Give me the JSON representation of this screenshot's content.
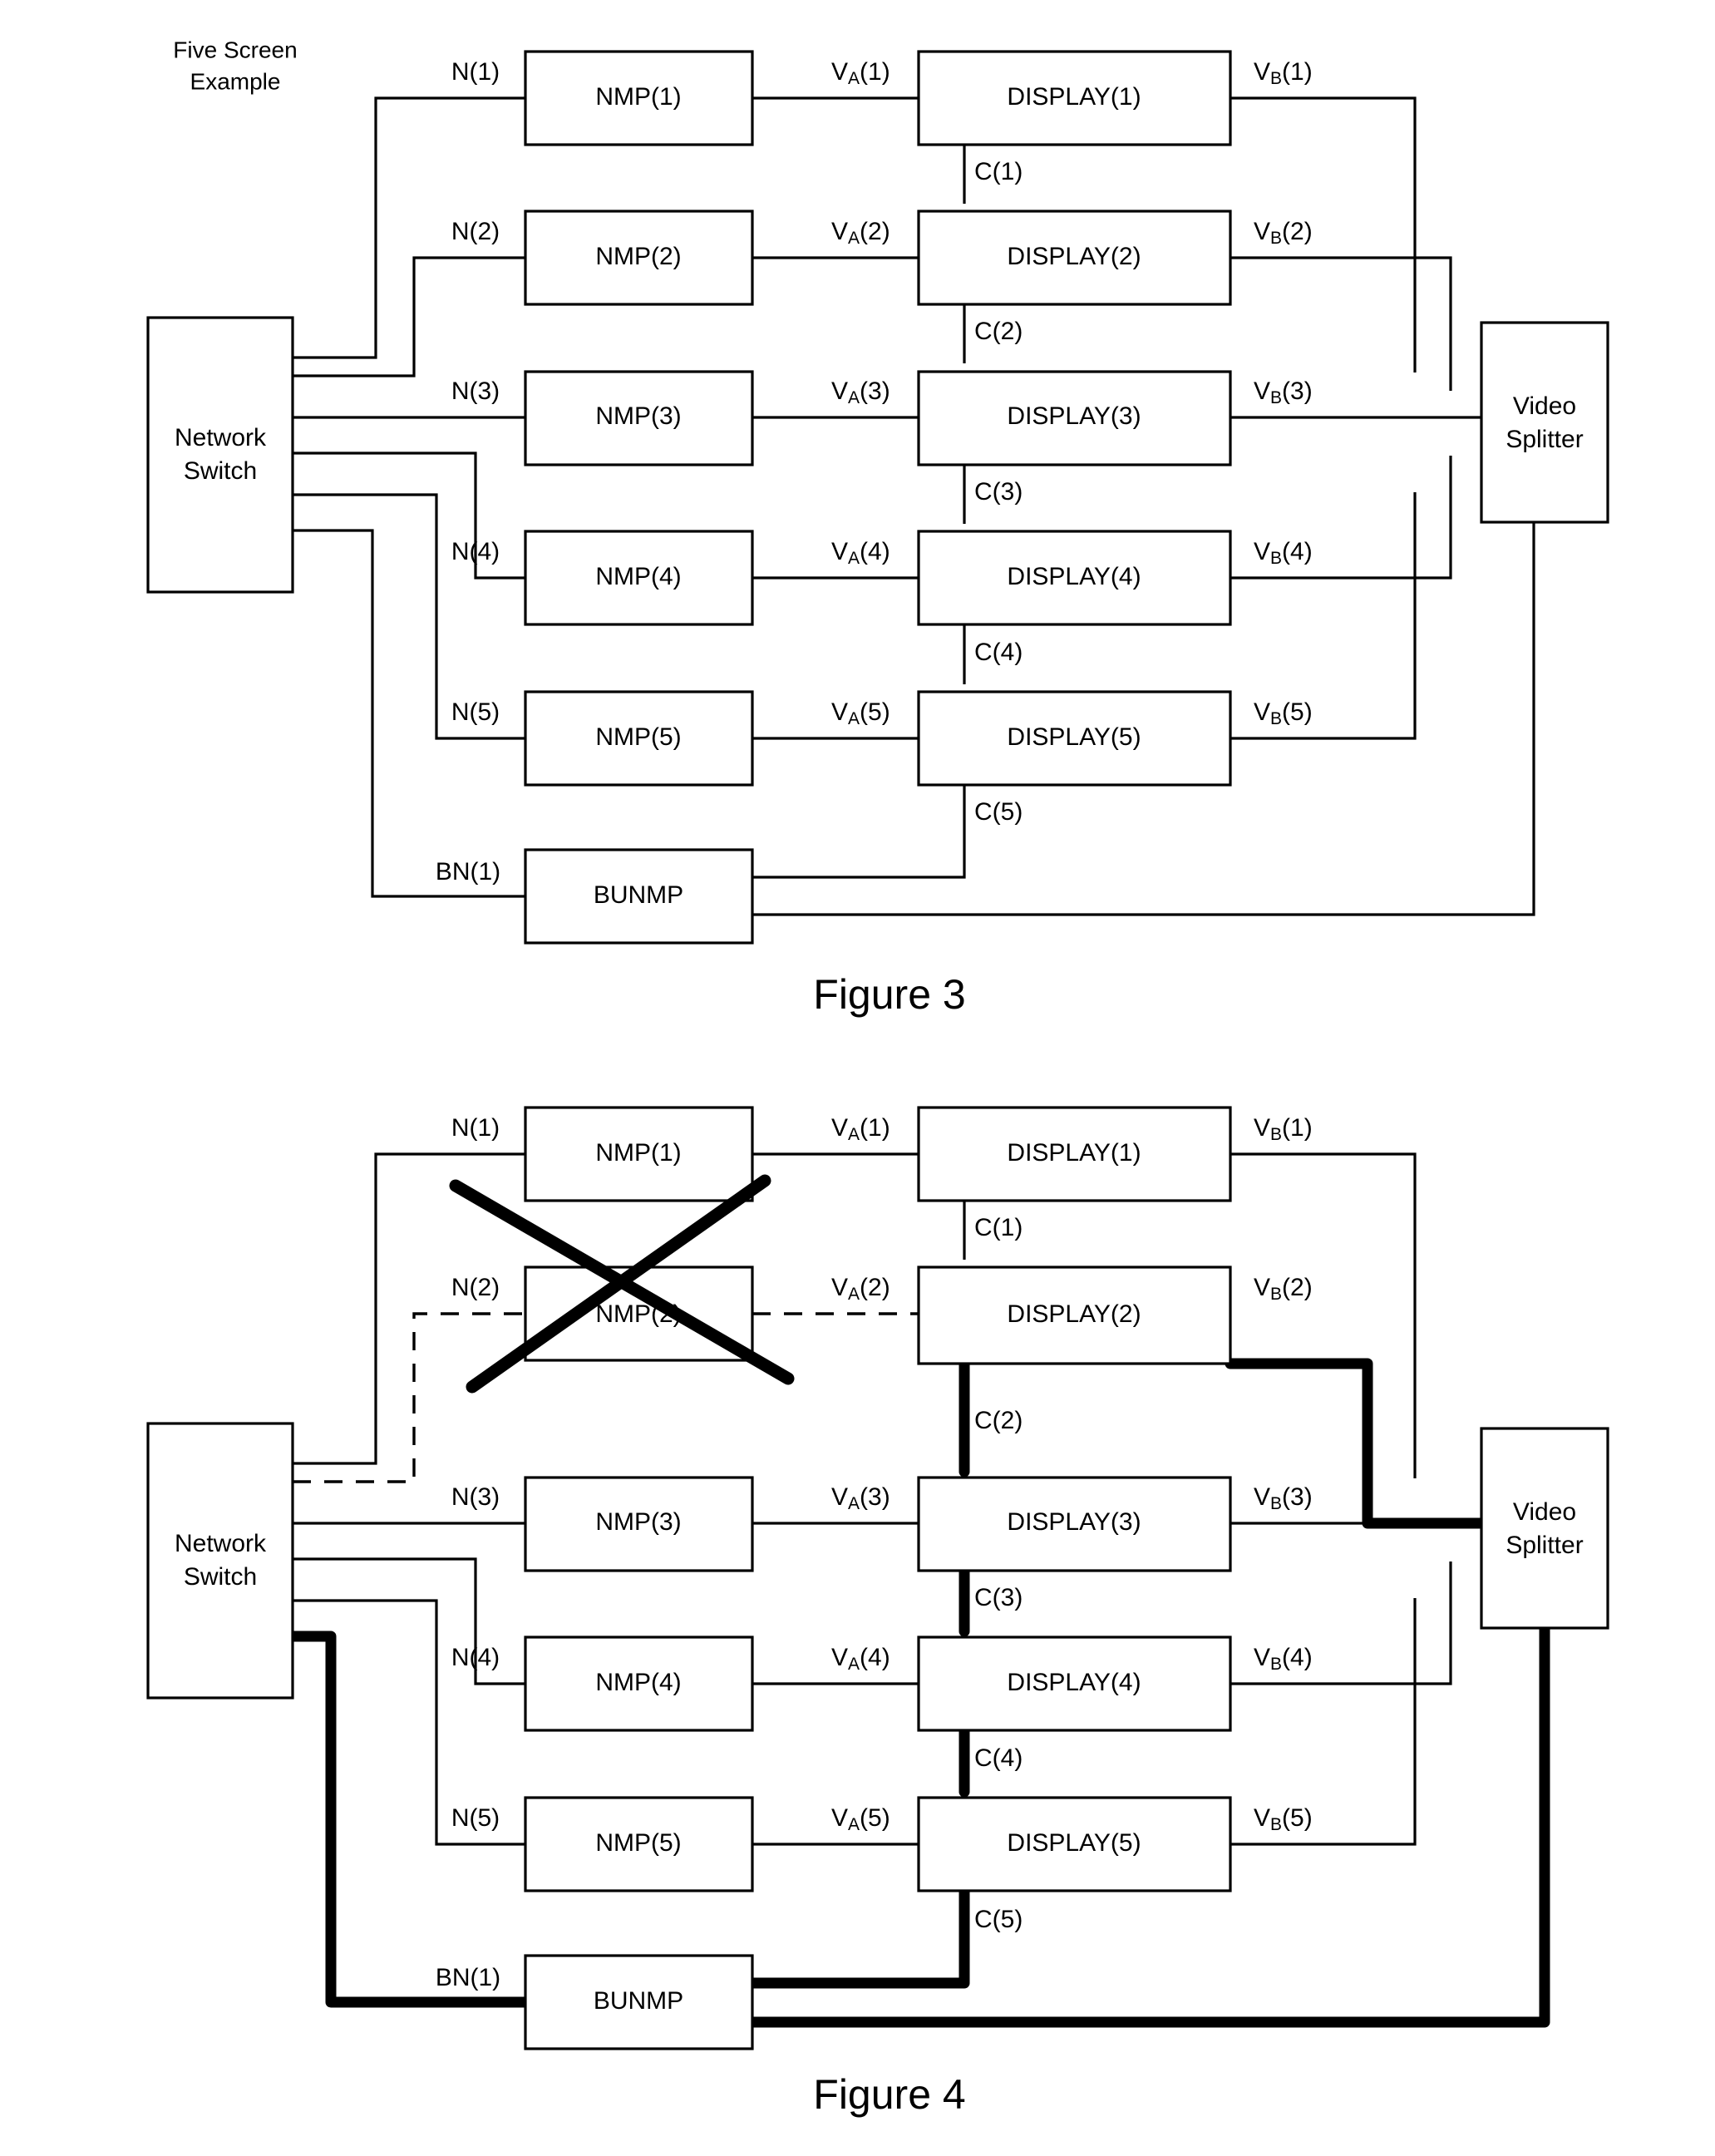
{
  "figures": [
    {
      "id": "figure-3",
      "caption": "Figure 3",
      "note": [
        "Five Screen",
        "Example"
      ],
      "switch_label": [
        "Network",
        "Switch"
      ],
      "splitter_label": [
        "Video",
        "Splitter"
      ],
      "bunmp_label": "BUNMP",
      "bn_label": "BN(1)",
      "rows": [
        {
          "n": "N(1)",
          "nmp": "NMP(1)",
          "va_pre": "V",
          "va_sub": "A",
          "va_post": "(1)",
          "display": "DISPLAY(1)",
          "vb_pre": "V",
          "vb_sub": "B",
          "vb_post": "(1)",
          "c": "C(1)"
        },
        {
          "n": "N(2)",
          "nmp": "NMP(2)",
          "va_pre": "V",
          "va_sub": "A",
          "va_post": "(2)",
          "display": "DISPLAY(2)",
          "vb_pre": "V",
          "vb_sub": "B",
          "vb_post": "(2)",
          "c": "C(2)"
        },
        {
          "n": "N(3)",
          "nmp": "NMP(3)",
          "va_pre": "V",
          "va_sub": "A",
          "va_post": "(3)",
          "display": "DISPLAY(3)",
          "vb_pre": "V",
          "vb_sub": "B",
          "vb_post": "(3)",
          "c": "C(3)"
        },
        {
          "n": "N(4)",
          "nmp": "NMP(4)",
          "va_pre": "V",
          "va_sub": "A",
          "va_post": "(4)",
          "display": "DISPLAY(4)",
          "vb_pre": "V",
          "vb_sub": "B",
          "vb_post": "(4)",
          "c": "C(4)"
        },
        {
          "n": "N(5)",
          "nmp": "NMP(5)",
          "va_pre": "V",
          "va_sub": "A",
          "va_post": "(5)",
          "display": "DISPLAY(5)",
          "vb_pre": "V",
          "vb_sub": "B",
          "vb_post": "(5)",
          "c": "C(5)"
        }
      ]
    },
    {
      "id": "figure-4",
      "caption": "Figure 4",
      "note": [
        "",
        ""
      ],
      "switch_label": [
        "Network",
        "Switch"
      ],
      "splitter_label": [
        "Video",
        "Splitter"
      ],
      "bunmp_label": "BUNMP",
      "bn_label": "BN(1)",
      "failed_row_index": 1,
      "rows": [
        {
          "n": "N(1)",
          "nmp": "NMP(1)",
          "va_pre": "V",
          "va_sub": "A",
          "va_post": "(1)",
          "display": "DISPLAY(1)",
          "vb_pre": "V",
          "vb_sub": "B",
          "vb_post": "(1)",
          "c": "C(1)"
        },
        {
          "n": "N(2)",
          "nmp": "NMP(2)",
          "va_pre": "V",
          "va_sub": "A",
          "va_post": "(2)",
          "display": "DISPLAY(2)",
          "vb_pre": "V",
          "vb_sub": "B",
          "vb_post": "(2)",
          "c": "C(2)"
        },
        {
          "n": "N(3)",
          "nmp": "NMP(3)",
          "va_pre": "V",
          "va_sub": "A",
          "va_post": "(3)",
          "display": "DISPLAY(3)",
          "vb_pre": "V",
          "vb_sub": "B",
          "vb_post": "(3)",
          "c": "C(3)"
        },
        {
          "n": "N(4)",
          "nmp": "NMP(4)",
          "va_pre": "V",
          "va_sub": "A",
          "va_post": "(4)",
          "display": "DISPLAY(4)",
          "vb_pre": "V",
          "vb_sub": "B",
          "vb_post": "(4)",
          "c": "C(4)"
        },
        {
          "n": "N(5)",
          "nmp": "NMP(5)",
          "va_pre": "V",
          "va_sub": "A",
          "va_post": "(5)",
          "display": "DISPLAY(5)",
          "vb_pre": "V",
          "vb_sub": "B",
          "vb_post": "(5)",
          "c": "C(5)"
        }
      ]
    }
  ],
  "colors": {
    "ink": "#000000",
    "paper": "#ffffff"
  }
}
